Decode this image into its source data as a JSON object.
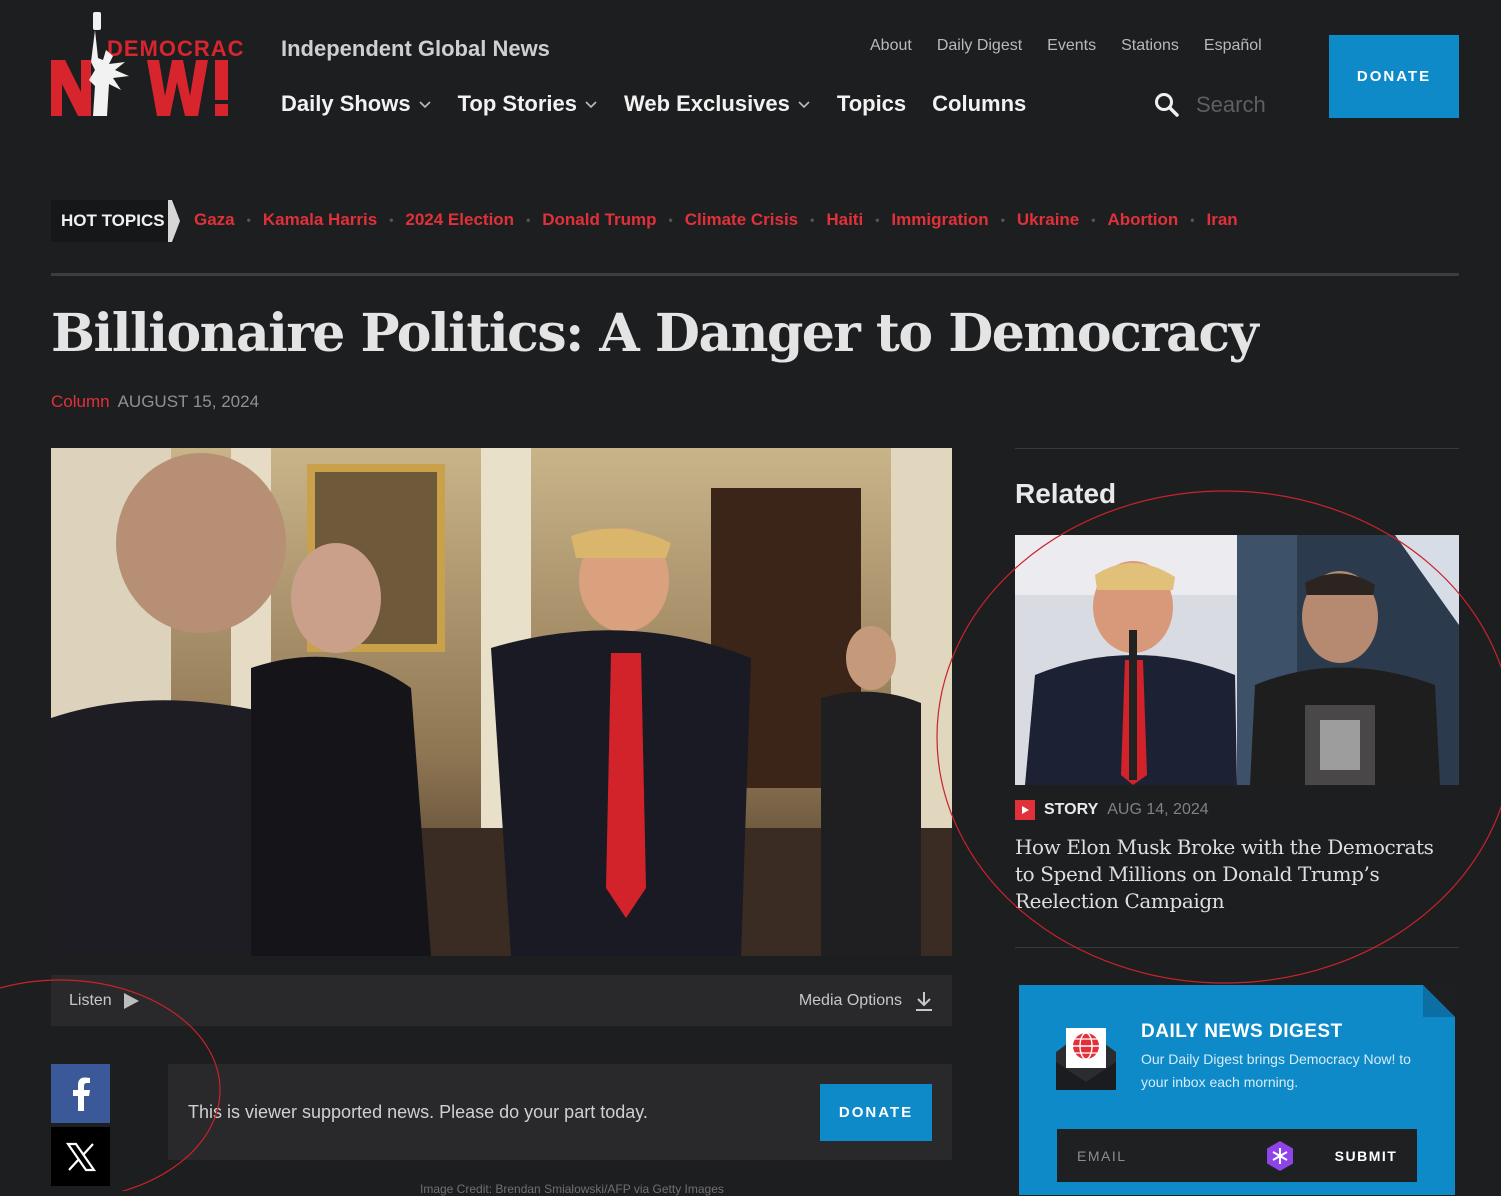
{
  "site": {
    "logo_text_top": "DEMOCRACY",
    "logo_text_bottom": "N   W!",
    "tagline": "Independent Global News",
    "brand_color": "#e0313a",
    "accent_color": "#0e8ac8"
  },
  "util_nav": [
    "About",
    "Daily Digest",
    "Events",
    "Stations",
    "Español"
  ],
  "main_nav": [
    {
      "label": "Daily Shows",
      "has_dropdown": true
    },
    {
      "label": "Top Stories",
      "has_dropdown": true
    },
    {
      "label": "Web Exclusives",
      "has_dropdown": true
    },
    {
      "label": "Topics",
      "has_dropdown": false
    },
    {
      "label": "Columns",
      "has_dropdown": false
    }
  ],
  "search": {
    "placeholder": "Search",
    "icon": "search-icon"
  },
  "donate_label": "DONATE",
  "hot_topics": {
    "label": "HOT TOPICS",
    "items": [
      "Gaza",
      "Kamala Harris",
      "2024 Election",
      "Donald Trump",
      "Climate Crisis",
      "Haiti",
      "Immigration",
      "Ukraine",
      "Abortion",
      "Iran"
    ]
  },
  "article": {
    "title": "Billionaire Politics: A Danger to Democracy",
    "type": "Column",
    "date": "AUGUST 15, 2024"
  },
  "player": {
    "listen_label": "Listen",
    "media_options_label": "Media Options"
  },
  "social": {
    "facebook_icon": "facebook-icon",
    "x_icon": "x-icon"
  },
  "support": {
    "text": "This is viewer supported news. Please do your part today.",
    "donate_label": "DONATE"
  },
  "related": {
    "heading": "Related",
    "kind": "STORY",
    "date": "AUG 14, 2024",
    "headline": "How Elon Musk Broke with the Democrats to Spend Millions on Donald Trump’s Reelection Campaign"
  },
  "digest": {
    "title": "DAILY NEWS DIGEST",
    "description": "Our Daily Digest brings Democracy Now! to your inbox each morning.",
    "email_placeholder": "EMAIL",
    "submit_label": "SUBMIT"
  },
  "caption_peek": "Image Credit: Brendan Smialowski/AFP via Getty Images"
}
